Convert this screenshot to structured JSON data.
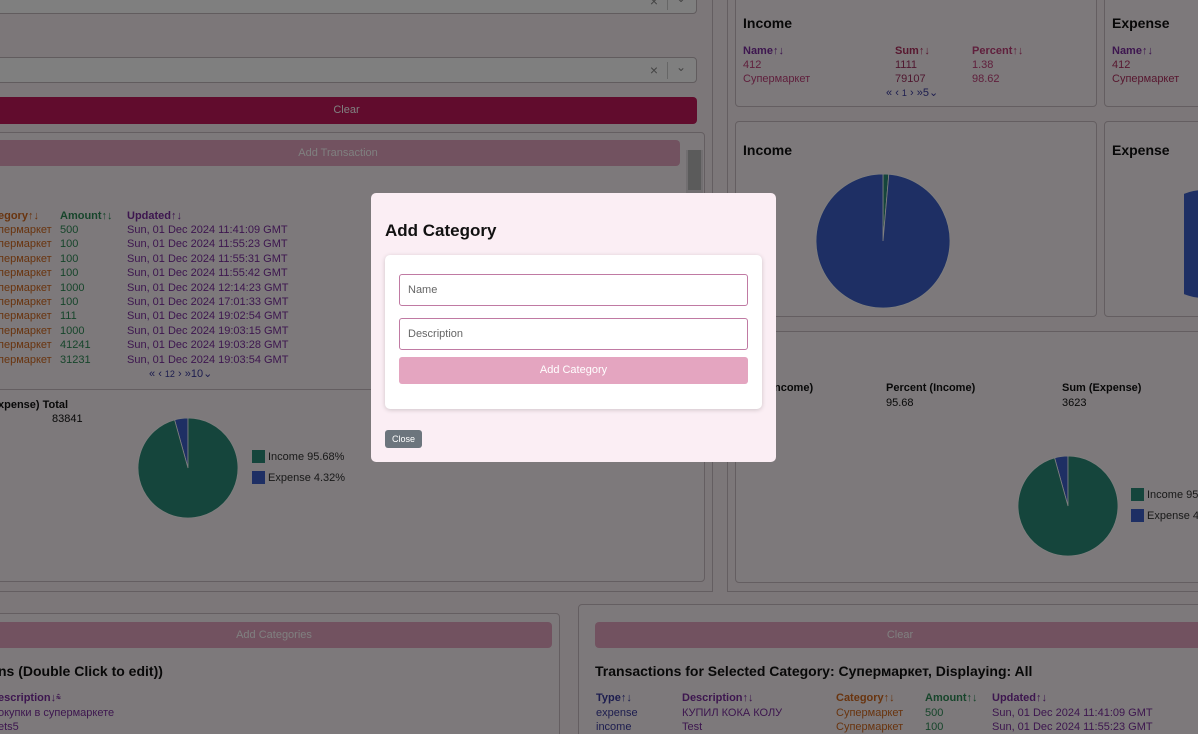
{
  "left": {
    "clear_label": "Clear",
    "add_transaction_label": "Add Transaction",
    "table_headers": [
      "egory↑↓",
      "Amount↑↓",
      "Updated↑↓"
    ],
    "rows": [
      {
        "category": "пермаркет",
        "amount": "500",
        "updated": "Sun, 01 Dec 2024 11:41:09 GMT"
      },
      {
        "category": "пермаркет",
        "amount": "100",
        "updated": "Sun, 01 Dec 2024 11:55:23 GMT"
      },
      {
        "category": "пермаркет",
        "amount": "100",
        "updated": "Sun, 01 Dec 2024 11:55:31 GMT"
      },
      {
        "category": "пермаркет",
        "amount": "100",
        "updated": "Sun, 01 Dec 2024 11:55:42 GMT"
      },
      {
        "category": "пермаркет",
        "amount": "1000",
        "updated": "Sun, 01 Dec 2024 12:14:23 GMT"
      },
      {
        "category": "пермаркет",
        "amount": "100",
        "updated": "Sun, 01 Dec 2024 17:01:33 GMT"
      },
      {
        "category": "пермаркет",
        "amount": "111",
        "updated": "Sun, 01 Dec 2024 19:02:54 GMT"
      },
      {
        "category": "пермаркет",
        "amount": "1000",
        "updated": "Sun, 01 Dec 2024 19:03:15 GMT"
      },
      {
        "category": "пермаркет",
        "amount": "41241",
        "updated": "Sun, 01 Dec 2024 19:03:28 GMT"
      },
      {
        "category": "пермаркет",
        "amount": "31231",
        "updated": "Sun, 01 Dec 2024 19:03:54 GMT"
      }
    ],
    "pagination": {
      "first": "«",
      "prev": "‹",
      "page": "12",
      "next": "›",
      "last": "»",
      "last_page": "10",
      "chevron": "⌄"
    },
    "summary_header": "xpense) Total",
    "summary_value": "83841",
    "legend": [
      {
        "label": "Income 95.68%",
        "color": "#2b8a78"
      },
      {
        "label": "Expense 4.32%",
        "color": "#3c5fc9"
      }
    ]
  },
  "right": {
    "income_table": {
      "title": "Income",
      "headers": [
        "Name↑↓",
        "Sum↑↓",
        "Percent↑↓"
      ],
      "rows": [
        {
          "name": "412",
          "sum": "1111",
          "percent": "1.38"
        },
        {
          "name": "Супермаркет",
          "sum": "79107",
          "percent": "98.62"
        }
      ],
      "pagination": {
        "first": "«",
        "prev": "‹",
        "page": "1",
        "next": "›",
        "last": "»",
        "last_page": "5",
        "chevron": "⌄"
      }
    },
    "expense_table": {
      "title": "Expense",
      "header": "Name↑↓",
      "rows": [
        "412",
        "Супермаркет"
      ]
    },
    "income_pie_title": "Income",
    "expense_pie_title": "Expense",
    "summary_headers": [
      "ncome)",
      "Percent (Income)",
      "Sum (Expense)"
    ],
    "summary_values": [
      "95.68",
      "3623"
    ],
    "legend": [
      {
        "label": "Income 95",
        "color": "#2b8a78"
      },
      {
        "label": "Expense 4",
        "color": "#3c5fc9"
      }
    ]
  },
  "bottom_left": {
    "add_categories_label": "Add Categories",
    "title": "ns (Double Click to edit))",
    "header": "escription↓",
    "header_icon": "filter-icon",
    "rows": [
      "окупки в супермаркете",
      "ets5"
    ]
  },
  "bottom_right": {
    "clear_label": "Clear",
    "title": "Transactions for Selected Category: Супермаркет, Displaying: All",
    "headers": [
      "Type↑↓",
      "Description↑↓",
      "Category↑↓",
      "Amount↑↓",
      "Updated↑↓"
    ],
    "rows": [
      {
        "type": "expense",
        "description": "КУПИЛ КОКА КОЛУ",
        "category": "Супермаркет",
        "amount": "500",
        "updated": "Sun, 01 Dec 2024 11:41:09 GMT"
      },
      {
        "type": "income",
        "description": "Test",
        "category": "Супермаркет",
        "amount": "100",
        "updated": "Sun, 01 Dec 2024 11:55:23 GMT"
      }
    ]
  },
  "modal": {
    "title": "Add Category",
    "name_placeholder": "Name",
    "description_placeholder": "Description",
    "add_label": "Add Category",
    "close_label": "Close"
  },
  "chart_data": [
    {
      "type": "pie",
      "categories": [
        "Income",
        "Expense"
      ],
      "values": [
        95.68,
        4.32
      ],
      "colors": [
        "#2b8a78",
        "#3c5fc9"
      ]
    },
    {
      "type": "pie",
      "title": "Income",
      "categories": [
        "412",
        "Супермаркет"
      ],
      "values": [
        1.38,
        98.62
      ],
      "colors": [
        "#2b8a78",
        "#3c5fc9"
      ]
    },
    {
      "type": "pie",
      "categories": [
        "Income",
        "Expense"
      ],
      "values": [
        95.68,
        4.32
      ],
      "colors": [
        "#2b8a78",
        "#3c5fc9"
      ]
    }
  ]
}
